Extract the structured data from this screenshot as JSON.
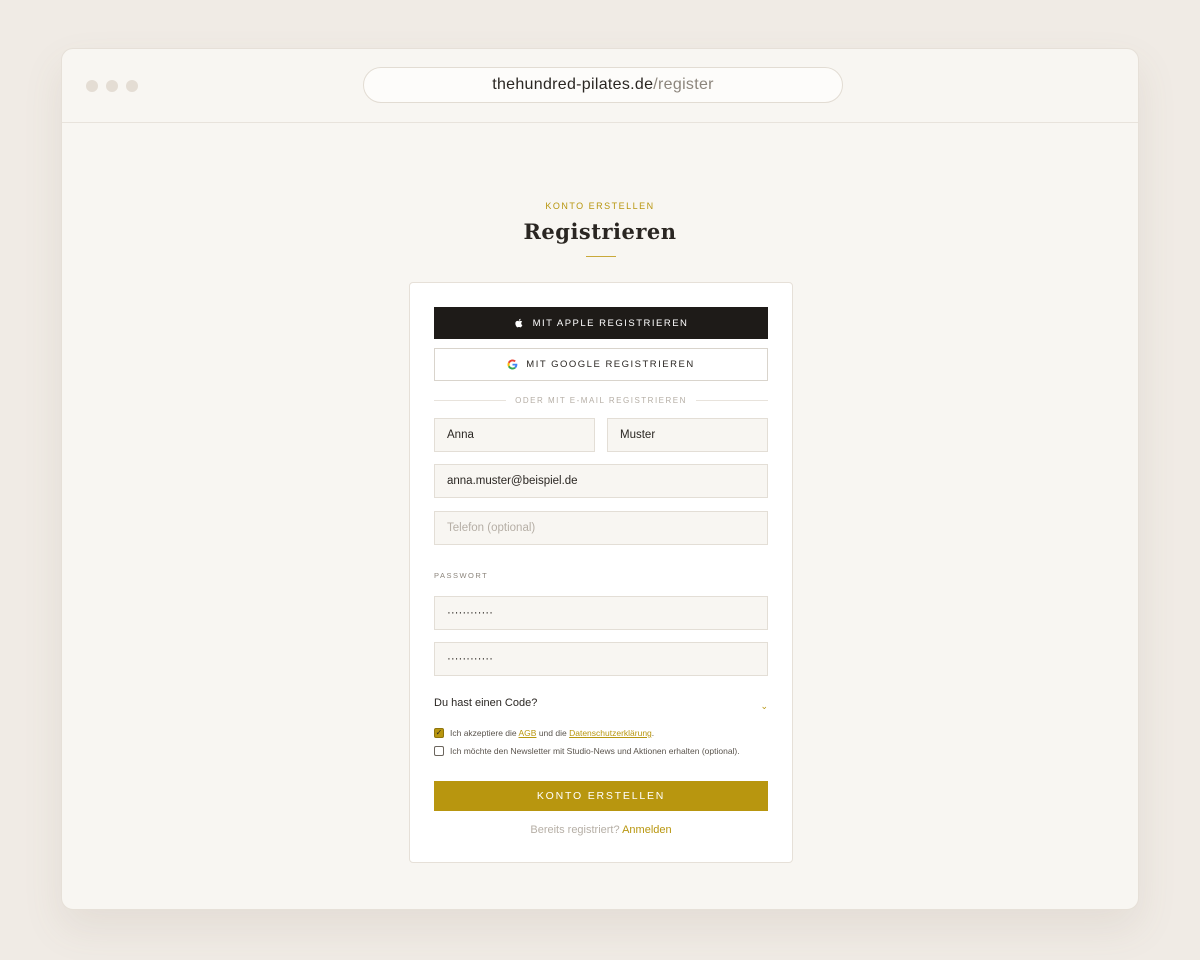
{
  "browser": {
    "url_domain": "thehundred-pilates.de",
    "url_path": "/register"
  },
  "header": {
    "eyebrow": "KONTO ERSTELLEN",
    "title": "Registrieren"
  },
  "social": {
    "apple_label": "MIT APPLE REGISTRIEREN",
    "google_label": "MIT GOOGLE REGISTRIEREN"
  },
  "divider_text": "ODER MIT E-MAIL REGISTRIEREN",
  "form": {
    "first_name_value": "Anna",
    "last_name_value": "Muster",
    "email_value": "anna.muster@beispiel.de",
    "phone_placeholder": "Telefon (optional)",
    "password_label": "PASSWORT",
    "password_value": "············",
    "password_confirm_value": "············",
    "code_toggle_label": "Du hast einen Code?",
    "code_toggle_icon": "chevron-down-icon"
  },
  "consent": {
    "terms_checked": true,
    "terms_text_before": "Ich akzeptiere die ",
    "terms_link": "AGB",
    "terms_text_mid": " und die ",
    "privacy_link": "Datenschutzerklärung",
    "terms_text_after": ".",
    "newsletter_checked": false,
    "newsletter_text": "Ich möchte den Newsletter mit Studio-News und Aktionen erhalten (optional)."
  },
  "submit_label": "KONTO ERSTELLEN",
  "login": {
    "prompt": "Bereits registriert?",
    "link": "Anmelden"
  },
  "colors": {
    "accent": "#b8960f",
    "dark": "#1e1b18",
    "background": "#f0ebe5"
  }
}
